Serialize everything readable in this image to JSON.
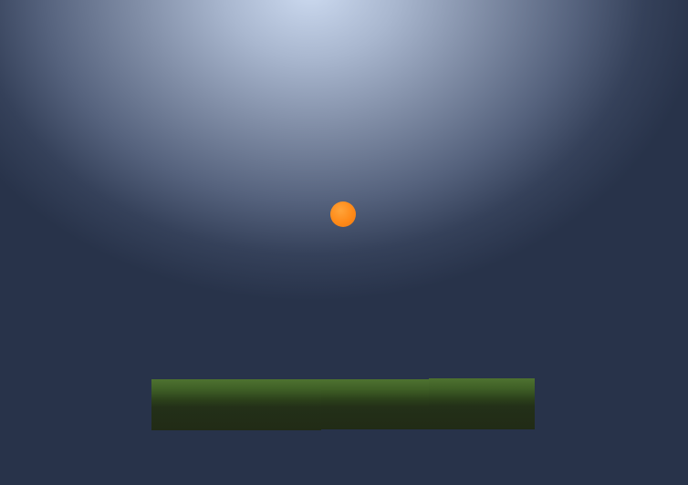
{
  "scene": {
    "background_top_color": "#ccdaf0",
    "background_bottom_color": "#28334a"
  },
  "ball": {
    "color": "#ff8a18",
    "icon": "ball-icon"
  },
  "platforms": {
    "top_color": "#4e7230",
    "bottom_color": "#212b16",
    "count": 3
  }
}
